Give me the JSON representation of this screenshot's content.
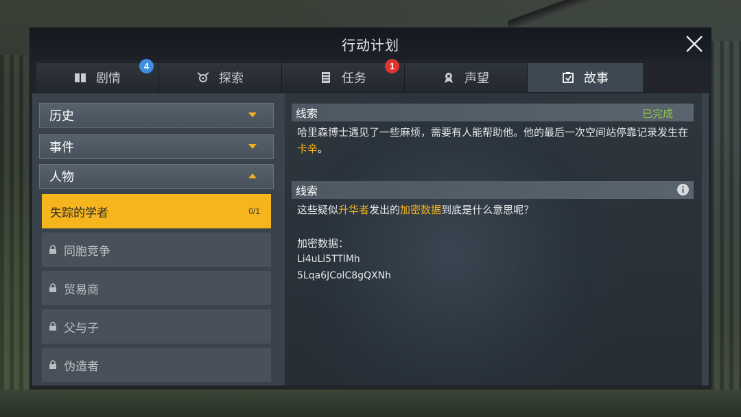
{
  "window": {
    "title": "行动计划",
    "close_icon": "close-icon"
  },
  "tabs": [
    {
      "label": "剧情",
      "icon": "book-icon",
      "badge": "4",
      "badge_color": "#3f8fe0",
      "active": false
    },
    {
      "label": "探索",
      "icon": "explore-icon",
      "badge": "",
      "active": false
    },
    {
      "label": "任务",
      "icon": "task-list-icon",
      "badge": "1",
      "badge_color": "#e0342f",
      "active": false
    },
    {
      "label": "声望",
      "icon": "reputation-icon",
      "badge": "",
      "active": false
    },
    {
      "label": "故事",
      "icon": "story-icon",
      "badge": "",
      "active": true
    }
  ],
  "categories": [
    {
      "label": "历史",
      "expanded": false
    },
    {
      "label": "事件",
      "expanded": false
    },
    {
      "label": "人物",
      "expanded": true
    }
  ],
  "stories": [
    {
      "label": "失踪的学者",
      "progress": "0/1",
      "locked": false,
      "selected": true
    },
    {
      "label": "同胞竞争",
      "locked": true
    },
    {
      "label": "贸易商",
      "locked": true
    },
    {
      "label": "父与子",
      "locked": true
    },
    {
      "label": "伪造者",
      "locked": true
    }
  ],
  "clue1": {
    "heading": "线索",
    "status": "已完成",
    "text_before": "哈里森博士遇见了一些麻烦，需要有人能帮助他。他的最后一次空间站停靠记录发生在",
    "highlight": "卡辛",
    "text_after": "。"
  },
  "clue2": {
    "heading": "线索",
    "text_1": "这些疑似",
    "highlight_1": "升华者",
    "text_2": "发出的",
    "highlight_2": "加密数据",
    "text_3": "到底是什么意思呢？",
    "data_label": "加密数据：",
    "data_line_1": "Li4uLi5TTlMh",
    "data_line_2": "5Lqa6JColC8gQXNh"
  },
  "colors": {
    "accent": "#f6b41d",
    "completed": "#8fc64a",
    "active_tab": "#3e4852"
  }
}
